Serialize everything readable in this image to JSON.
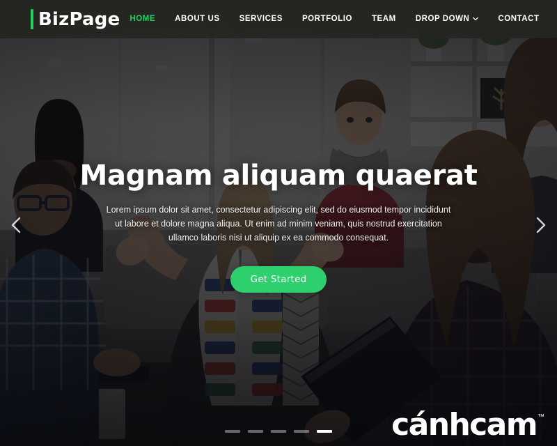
{
  "header": {
    "logo": {
      "text": "BizPage",
      "accent_color": "#1fd35e"
    },
    "nav": [
      {
        "label": "HOME",
        "name": "nav-home",
        "active": true,
        "dropdown": false
      },
      {
        "label": "ABOUT US",
        "name": "nav-about-us",
        "active": false,
        "dropdown": false
      },
      {
        "label": "SERVICES",
        "name": "nav-services",
        "active": false,
        "dropdown": false
      },
      {
        "label": "PORTFOLIO",
        "name": "nav-portfolio",
        "active": false,
        "dropdown": false
      },
      {
        "label": "TEAM",
        "name": "nav-team",
        "active": false,
        "dropdown": false
      },
      {
        "label": "DROP DOWN",
        "name": "nav-drop-down",
        "active": false,
        "dropdown": true
      },
      {
        "label": "CONTACT",
        "name": "nav-contact",
        "active": false,
        "dropdown": false
      }
    ],
    "background_color": "#252521"
  },
  "hero": {
    "title": "Magnam aliquam quaerat",
    "description": "Lorem ipsum dolor sit amet, consectetur adipiscing elit, sed do eiusmod tempor incididunt ut labore et dolore magna aliqua. Ut enim ad minim veniam, quis nostrud exercitation ullamco laboris nisi ut aliquip ex ea commodo consequat.",
    "cta_label": "Get Started",
    "cta_color": "#2ed06d",
    "background_description": "office meeting photo with people seated around a table, darkened overlay"
  },
  "carousel": {
    "prev_icon": "chevron-left-icon",
    "next_icon": "chevron-right-icon",
    "slide_count": 5,
    "active_slide": 5
  },
  "watermark": {
    "text": "cánhcam",
    "trademark": "™"
  }
}
